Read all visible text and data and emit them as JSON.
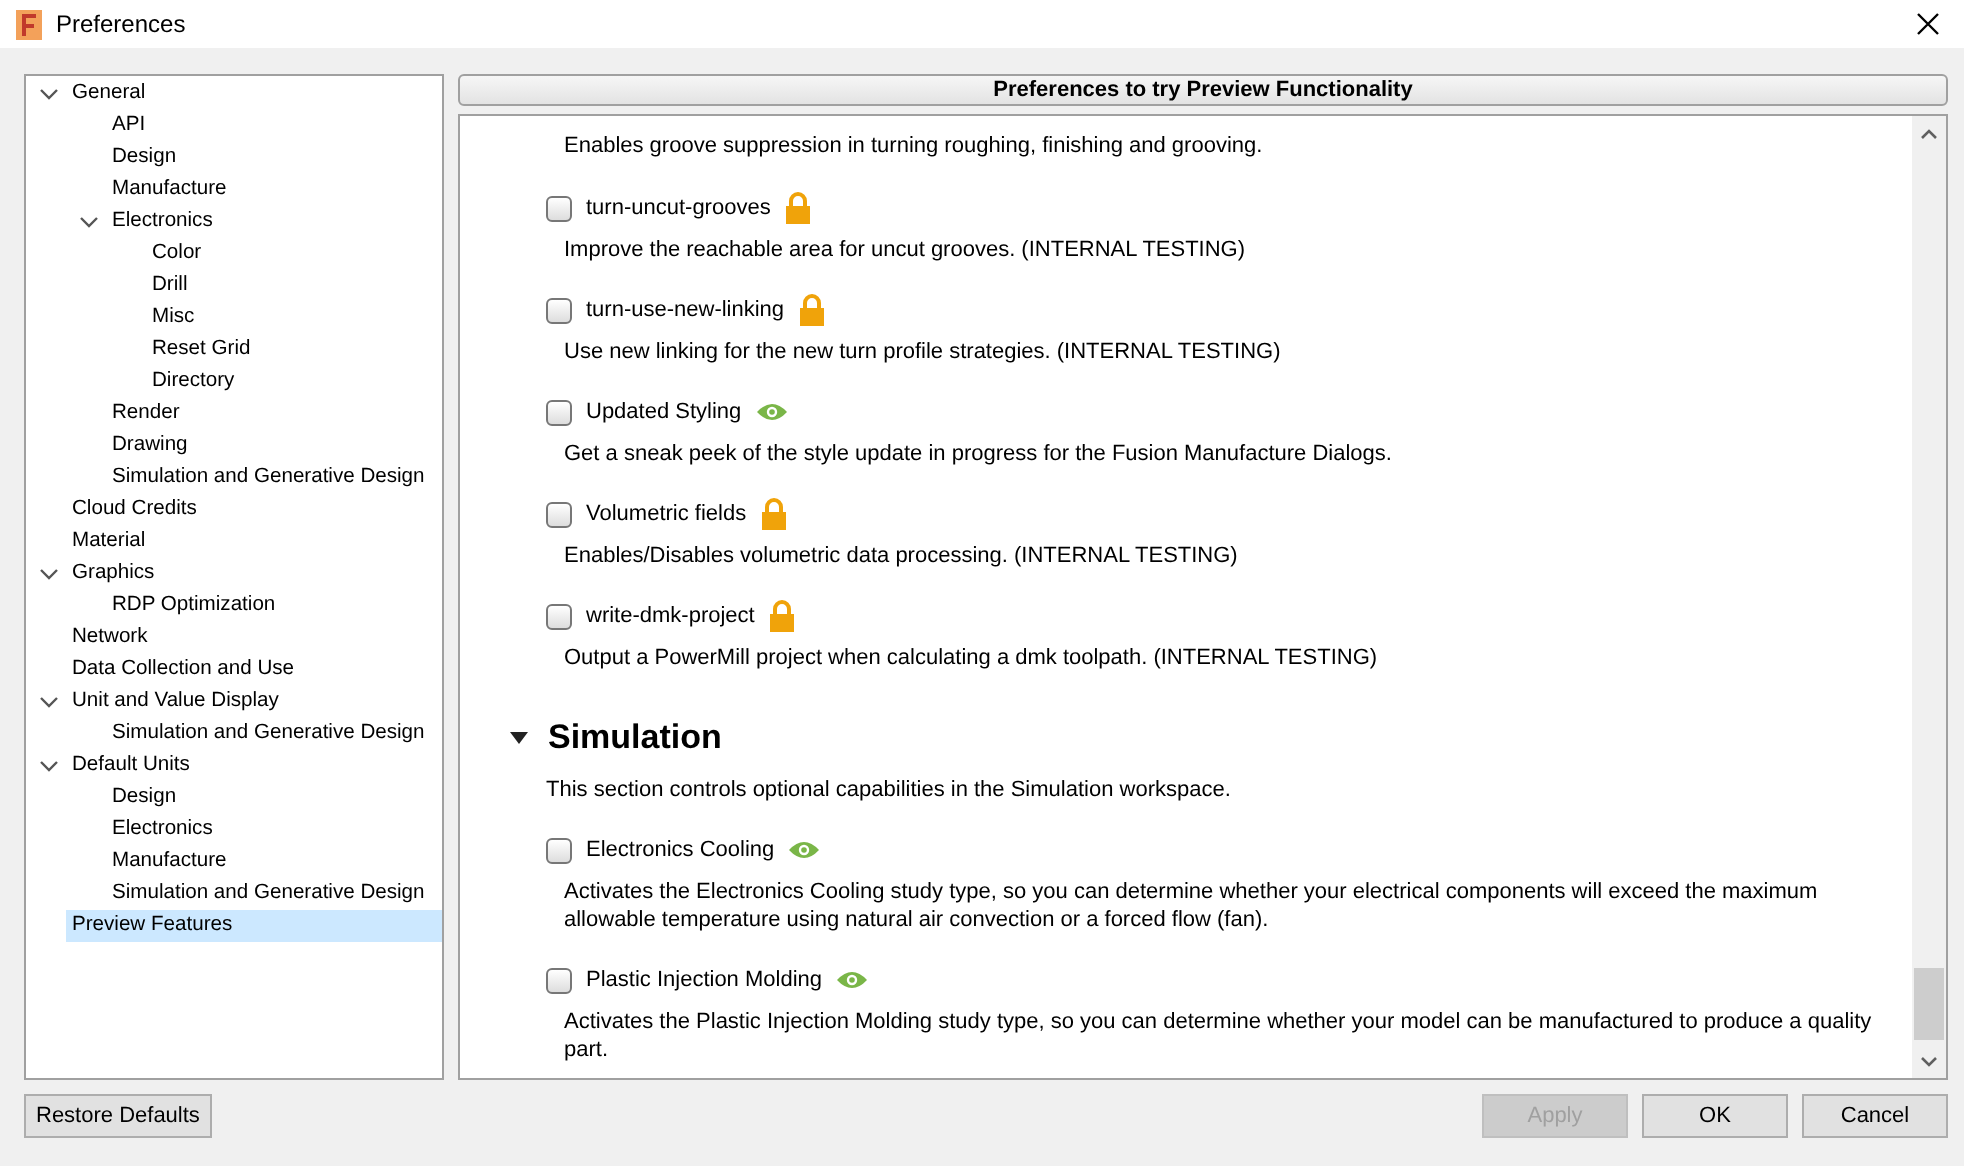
{
  "window": {
    "title": "Preferences"
  },
  "tree": [
    {
      "label": "General",
      "expanded": true,
      "selected": false,
      "children": [
        {
          "label": "API",
          "selected": false
        },
        {
          "label": "Design",
          "selected": false
        },
        {
          "label": "Manufacture",
          "selected": false
        },
        {
          "label": "Electronics",
          "expanded": true,
          "selected": false,
          "children": [
            {
              "label": "Color",
              "selected": false
            },
            {
              "label": "Drill",
              "selected": false
            },
            {
              "label": "Misc",
              "selected": false
            },
            {
              "label": "Reset Grid",
              "selected": false
            },
            {
              "label": "Directory",
              "selected": false
            }
          ]
        },
        {
          "label": "Render",
          "selected": false
        },
        {
          "label": "Drawing",
          "selected": false
        },
        {
          "label": "Simulation and Generative Design",
          "selected": false
        }
      ]
    },
    {
      "label": "Cloud Credits",
      "selected": false
    },
    {
      "label": "Material",
      "selected": false
    },
    {
      "label": "Graphics",
      "expanded": true,
      "selected": false,
      "children": [
        {
          "label": "RDP Optimization",
          "selected": false
        }
      ]
    },
    {
      "label": "Network",
      "selected": false
    },
    {
      "label": "Data Collection and Use",
      "selected": false
    },
    {
      "label": "Unit and Value Display",
      "expanded": true,
      "selected": false,
      "children": [
        {
          "label": "Simulation and Generative Design",
          "selected": false
        }
      ]
    },
    {
      "label": "Default Units",
      "expanded": true,
      "selected": false,
      "children": [
        {
          "label": "Design",
          "selected": false
        },
        {
          "label": "Electronics",
          "selected": false
        },
        {
          "label": "Manufacture",
          "selected": false
        },
        {
          "label": "Simulation and Generative Design",
          "selected": false
        }
      ]
    },
    {
      "label": "Preview Features",
      "selected": true
    }
  ],
  "panel": {
    "title": "Preferences to try Preview Functionality",
    "items": [
      {
        "kind": "description",
        "text": "Enables groove suppression in turning roughing, finishing and grooving."
      },
      {
        "kind": "feature",
        "label": "turn-uncut-grooves",
        "checked": false,
        "locked": true,
        "text": "Improve the reachable area for uncut grooves. (INTERNAL TESTING)"
      },
      {
        "kind": "feature",
        "label": "turn-use-new-linking",
        "checked": false,
        "locked": true,
        "text": "Use new linking for the new turn profile strategies. (INTERNAL TESTING)"
      },
      {
        "kind": "feature",
        "label": "Updated Styling",
        "checked": false,
        "locked": false,
        "text": "Get a sneak peek of the style update in progress for the Fusion Manufacture Dialogs."
      },
      {
        "kind": "feature",
        "label": "Volumetric fields",
        "checked": false,
        "locked": true,
        "text": "Enables/Disables volumetric data processing. (INTERNAL TESTING)"
      },
      {
        "kind": "feature",
        "label": "write-dmk-project",
        "checked": false,
        "locked": true,
        "text": "Output a PowerMill project when calculating a dmk toolpath. (INTERNAL TESTING)"
      },
      {
        "kind": "section",
        "label": "Simulation",
        "expanded": true,
        "text": "This section controls optional capabilities in the Simulation workspace."
      },
      {
        "kind": "feature",
        "label": "Electronics Cooling",
        "checked": false,
        "locked": false,
        "text": "Activates the Electronics Cooling study type, so you can determine whether your electrical components will exceed the maximum allowable temperature using natural air convection or a forced flow (fan)."
      },
      {
        "kind": "feature",
        "label": "Plastic Injection Molding",
        "checked": false,
        "locked": false,
        "text": "Activates the Plastic Injection Molding study type, so you can determine whether your model can be manufactured to produce a quality part."
      }
    ]
  },
  "buttons": [
    {
      "label": "Restore Defaults",
      "disabled": false
    },
    {
      "label": "Apply",
      "disabled": true
    },
    {
      "label": "OK",
      "disabled": false
    },
    {
      "label": "Cancel",
      "disabled": false
    }
  ]
}
